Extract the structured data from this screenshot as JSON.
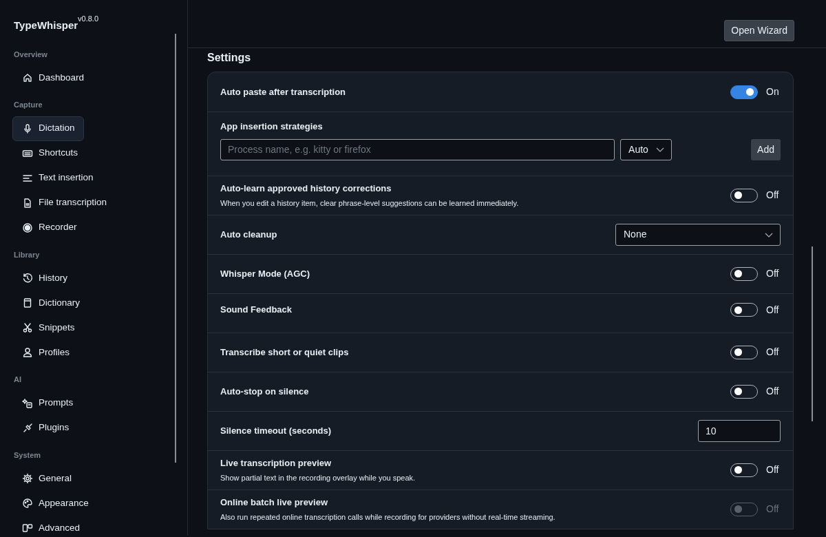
{
  "app": {
    "title": "TypeWhisper",
    "version": "v0.8.0"
  },
  "sidebar": {
    "sections": [
      {
        "heading": "Overview",
        "items": [
          {
            "label": "Dashboard",
            "selected": false
          }
        ]
      },
      {
        "heading": "Capture",
        "items": [
          {
            "label": "Dictation",
            "selected": true
          },
          {
            "label": "Shortcuts",
            "selected": false
          },
          {
            "label": "Text insertion",
            "selected": false
          },
          {
            "label": "File transcription",
            "selected": false
          },
          {
            "label": "Recorder",
            "selected": false
          }
        ]
      },
      {
        "heading": "Library",
        "items": [
          {
            "label": "History",
            "selected": false
          },
          {
            "label": "Dictionary",
            "selected": false
          },
          {
            "label": "Snippets",
            "selected": false
          },
          {
            "label": "Profiles",
            "selected": false
          }
        ]
      },
      {
        "heading": "AI",
        "items": [
          {
            "label": "Prompts",
            "selected": false
          },
          {
            "label": "Plugins",
            "selected": false
          }
        ]
      },
      {
        "heading": "System",
        "items": [
          {
            "label": "General",
            "selected": false
          },
          {
            "label": "Appearance",
            "selected": false
          },
          {
            "label": "Advanced",
            "selected": false
          }
        ]
      }
    ]
  },
  "header": {
    "button": "Open Wizard"
  },
  "settings": {
    "title": "Settings",
    "rows": [
      {
        "kind": "toggle",
        "label": "Auto paste after transcription",
        "on": true,
        "disabled": false,
        "state_label": "On"
      },
      {
        "kind": "strategies",
        "label": "App insertion strategies",
        "placeholder": "Process name, e.g. kitty or firefox",
        "mode": "Auto",
        "button": "Add"
      },
      {
        "kind": "toggle",
        "label": "Auto-learn approved history corrections",
        "description": "When you edit a history item, clear phrase-level suggestions can be learned immediately.",
        "on": false,
        "disabled": false,
        "state_label": "Off"
      },
      {
        "kind": "select",
        "label": "Auto cleanup",
        "value": "None"
      },
      {
        "kind": "toggle",
        "label": "Whisper Mode (AGC)",
        "on": false,
        "disabled": false,
        "state_label": "Off"
      },
      {
        "kind": "toggle",
        "label": "Sound Feedback",
        "on": false,
        "disabled": false,
        "state_label": "Off",
        "top": true
      },
      {
        "kind": "toggle",
        "label": "Transcribe short or quiet clips",
        "on": false,
        "disabled": false,
        "state_label": "Off"
      },
      {
        "kind": "toggle",
        "label": "Auto-stop on silence",
        "on": false,
        "disabled": false,
        "state_label": "Off"
      },
      {
        "kind": "number",
        "label": "Silence timeout (seconds)",
        "value": "10"
      },
      {
        "kind": "toggle",
        "label": "Live transcription preview",
        "description": "Show partial text in the recording overlay while you speak.",
        "on": false,
        "disabled": false,
        "state_label": "Off"
      },
      {
        "kind": "toggle",
        "label": "Online batch live preview",
        "description": "Also run repeated online transcription calls while recording for providers without real-time streaming.",
        "on": false,
        "disabled": true,
        "state_label": "Off"
      }
    ]
  }
}
